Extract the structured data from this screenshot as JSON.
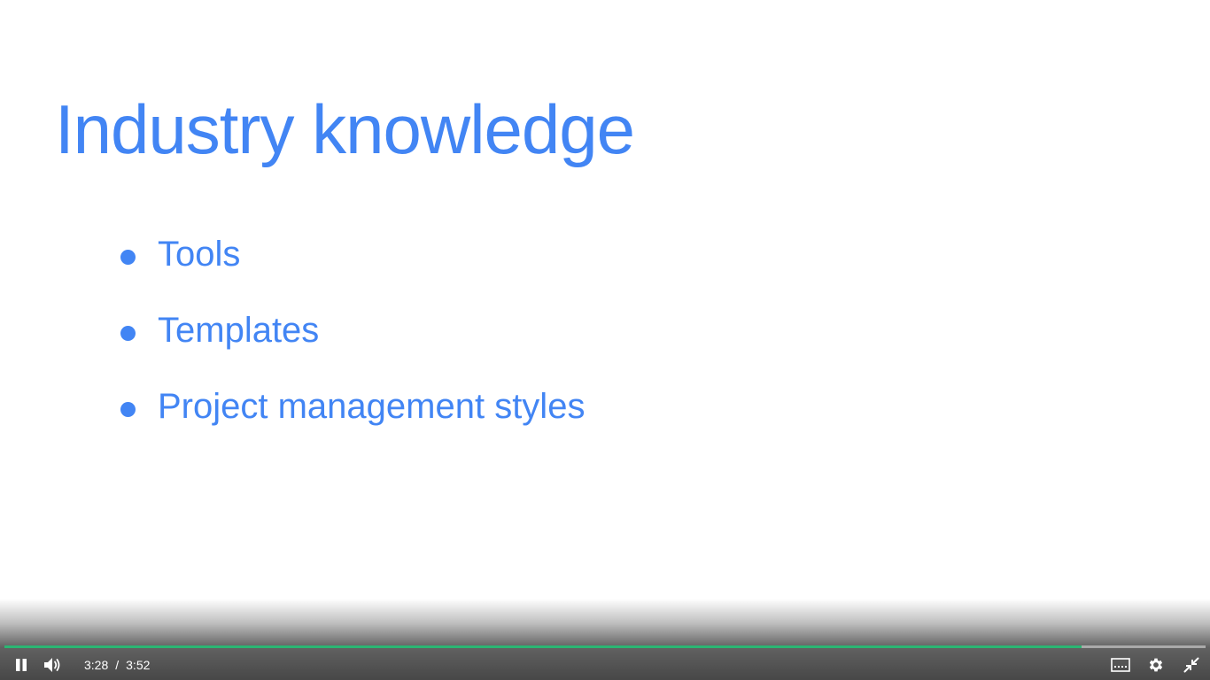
{
  "slide": {
    "title": "Industry knowledge",
    "bullets": [
      {
        "text": "Tools"
      },
      {
        "text": "Templates"
      },
      {
        "text": "Project management styles"
      }
    ],
    "text_color": "#4285f4"
  },
  "player": {
    "current_time": "3:28",
    "time_separator": "/",
    "duration": "3:52",
    "progress_fraction": 0.897,
    "progress_color": "#2bb673",
    "state": "playing",
    "icons": {
      "play": "pause-icon",
      "volume": "volume-icon",
      "captions": "captions-icon",
      "settings": "gear-icon",
      "fullscreen": "exit-fullscreen-icon"
    }
  }
}
